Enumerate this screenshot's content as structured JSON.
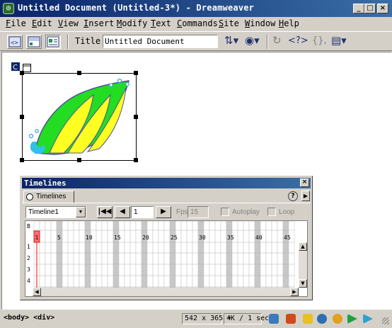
{
  "window": {
    "title": "Untitled Document (Untitled-3*) - Dreamweaver",
    "app_icon": "dw-app-icon",
    "controls": [
      "minimize",
      "maximize",
      "close"
    ]
  },
  "menubar": {
    "items": [
      {
        "label": "File",
        "mnemonic": "F"
      },
      {
        "label": "Edit",
        "mnemonic": "E"
      },
      {
        "label": "View",
        "mnemonic": "V"
      },
      {
        "label": "Insert",
        "mnemonic": "I"
      },
      {
        "label": "Modify",
        "mnemonic": "M"
      },
      {
        "label": "Text",
        "mnemonic": "T"
      },
      {
        "label": "Commands",
        "mnemonic": "C"
      },
      {
        "label": "Site",
        "mnemonic": "S"
      },
      {
        "label": "Window",
        "mnemonic": "W"
      },
      {
        "label": "Help",
        "mnemonic": "H"
      }
    ]
  },
  "toolbar": {
    "view_buttons": [
      "code-view-icon",
      "code-design-view-icon",
      "design-view-icon"
    ],
    "active_view": "design-view-icon",
    "title_label": "Title:",
    "title_value": "Untitled Document",
    "right_icons": [
      "file-management-icon",
      "preview-browser-icon",
      "refresh-icon",
      "reference-icon",
      "code-navigation-icon",
      "view-options-icon"
    ]
  },
  "timelines": {
    "panel_title": "Timelines",
    "tab_label": "Timelines",
    "timeline_name": "Timeline1",
    "frame_value": "1",
    "fps_label": "Fps",
    "fps_value": "15",
    "autoplay_label": "Autoplay",
    "loop_label": "Loop",
    "behavior_row_label": "B",
    "frame_numbers": [
      "1",
      "5",
      "10",
      "15",
      "20",
      "25",
      "30",
      "35",
      "40",
      "45"
    ],
    "channel_labels": [
      "1",
      "2",
      "3",
      "4"
    ],
    "playhead_frame": 1
  },
  "statusbar": {
    "tags": "<body> <div>",
    "window_size": "542 x 365",
    "download_stats": "4K / 1 sec",
    "launcher_icons": [
      "site-icon",
      "assets-icon",
      "html-styles-icon",
      "css-styles-icon",
      "behaviors-icon",
      "history-icon",
      "code-inspector-icon"
    ]
  },
  "colors": {
    "titlebar_start": "#0a246a",
    "titlebar_end": "#3a6ea5",
    "chrome": "#d4d0c8",
    "playhead": "#ff6f6f",
    "wave_green": "#22dd22",
    "wave_yellow": "#ffff22",
    "wave_outline": "#5050a0",
    "splash": "#30c0e8"
  }
}
